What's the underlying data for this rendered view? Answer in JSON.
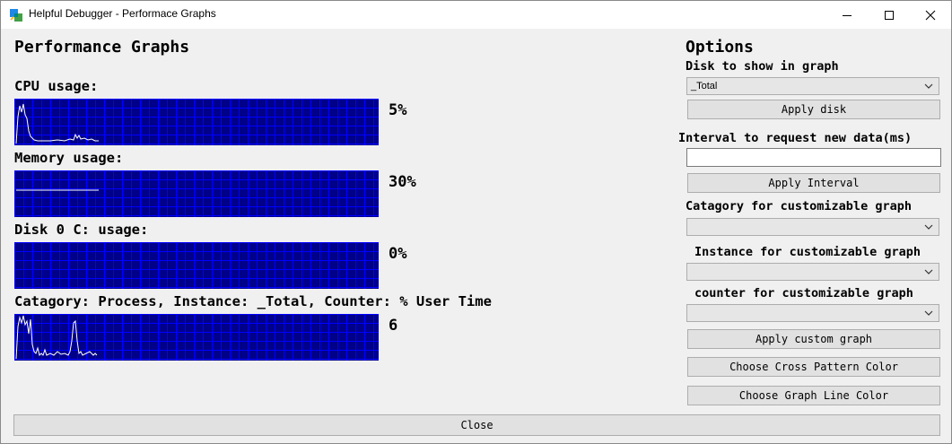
{
  "window": {
    "title": "Helpful Debugger - Performace Graphs"
  },
  "main": {
    "heading": "Performance Graphs",
    "graphs": [
      {
        "label": "CPU usage:",
        "value": "5%",
        "line_color": "#ffffff"
      },
      {
        "label": "Memory usage:",
        "value": "30%",
        "line_color": "#ffffff"
      },
      {
        "label": "Disk 0 C: usage:",
        "value": "0%",
        "line_color": "#ffffff"
      },
      {
        "label": "Catagory: Process, Instance: _Total, Counter: % User Time",
        "value": "6",
        "line_color": "#ffffff"
      }
    ],
    "graph_background": "#00008b",
    "cross_pattern_color": "#0000ff"
  },
  "options": {
    "heading": "Options",
    "disk_label": "Disk to show in graph",
    "disk_selected": "_Total",
    "apply_disk": "Apply disk",
    "interval_label": "Interval to request new data(ms)",
    "interval_value": "",
    "apply_interval": "Apply Interval",
    "category_label": "Catagory for customizable graph",
    "category_selected": "",
    "instance_label": "Instance for customizable graph",
    "instance_selected": "",
    "counter_label": "counter for customizable graph",
    "counter_selected": "",
    "apply_custom": "Apply custom graph",
    "cross_color_button": "Choose Cross Pattern Color",
    "line_color_button": "Choose Graph Line Color"
  },
  "footer": {
    "close_label": "Close"
  }
}
